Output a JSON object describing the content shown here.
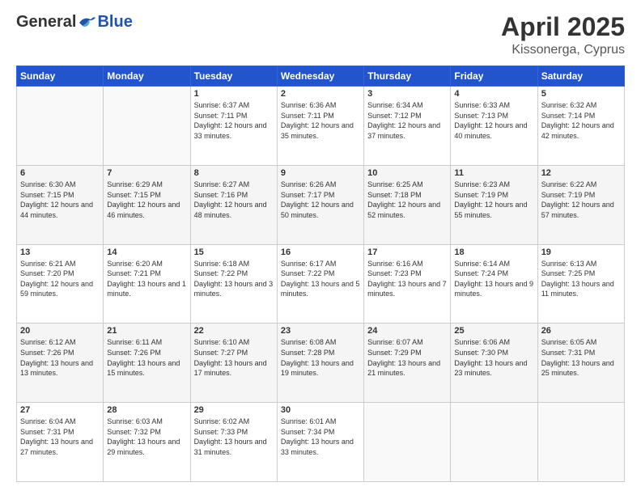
{
  "header": {
    "logo_general": "General",
    "logo_blue": "Blue",
    "title": "April 2025",
    "subtitle": "Kissonerga, Cyprus"
  },
  "calendar": {
    "weekdays": [
      "Sunday",
      "Monday",
      "Tuesday",
      "Wednesday",
      "Thursday",
      "Friday",
      "Saturday"
    ],
    "rows": [
      [
        {
          "day": "",
          "info": ""
        },
        {
          "day": "",
          "info": ""
        },
        {
          "day": "1",
          "info": "Sunrise: 6:37 AM\nSunset: 7:11 PM\nDaylight: 12 hours and 33 minutes."
        },
        {
          "day": "2",
          "info": "Sunrise: 6:36 AM\nSunset: 7:11 PM\nDaylight: 12 hours and 35 minutes."
        },
        {
          "day": "3",
          "info": "Sunrise: 6:34 AM\nSunset: 7:12 PM\nDaylight: 12 hours and 37 minutes."
        },
        {
          "day": "4",
          "info": "Sunrise: 6:33 AM\nSunset: 7:13 PM\nDaylight: 12 hours and 40 minutes."
        },
        {
          "day": "5",
          "info": "Sunrise: 6:32 AM\nSunset: 7:14 PM\nDaylight: 12 hours and 42 minutes."
        }
      ],
      [
        {
          "day": "6",
          "info": "Sunrise: 6:30 AM\nSunset: 7:15 PM\nDaylight: 12 hours and 44 minutes."
        },
        {
          "day": "7",
          "info": "Sunrise: 6:29 AM\nSunset: 7:15 PM\nDaylight: 12 hours and 46 minutes."
        },
        {
          "day": "8",
          "info": "Sunrise: 6:27 AM\nSunset: 7:16 PM\nDaylight: 12 hours and 48 minutes."
        },
        {
          "day": "9",
          "info": "Sunrise: 6:26 AM\nSunset: 7:17 PM\nDaylight: 12 hours and 50 minutes."
        },
        {
          "day": "10",
          "info": "Sunrise: 6:25 AM\nSunset: 7:18 PM\nDaylight: 12 hours and 52 minutes."
        },
        {
          "day": "11",
          "info": "Sunrise: 6:23 AM\nSunset: 7:19 PM\nDaylight: 12 hours and 55 minutes."
        },
        {
          "day": "12",
          "info": "Sunrise: 6:22 AM\nSunset: 7:19 PM\nDaylight: 12 hours and 57 minutes."
        }
      ],
      [
        {
          "day": "13",
          "info": "Sunrise: 6:21 AM\nSunset: 7:20 PM\nDaylight: 12 hours and 59 minutes."
        },
        {
          "day": "14",
          "info": "Sunrise: 6:20 AM\nSunset: 7:21 PM\nDaylight: 13 hours and 1 minute."
        },
        {
          "day": "15",
          "info": "Sunrise: 6:18 AM\nSunset: 7:22 PM\nDaylight: 13 hours and 3 minutes."
        },
        {
          "day": "16",
          "info": "Sunrise: 6:17 AM\nSunset: 7:22 PM\nDaylight: 13 hours and 5 minutes."
        },
        {
          "day": "17",
          "info": "Sunrise: 6:16 AM\nSunset: 7:23 PM\nDaylight: 13 hours and 7 minutes."
        },
        {
          "day": "18",
          "info": "Sunrise: 6:14 AM\nSunset: 7:24 PM\nDaylight: 13 hours and 9 minutes."
        },
        {
          "day": "19",
          "info": "Sunrise: 6:13 AM\nSunset: 7:25 PM\nDaylight: 13 hours and 11 minutes."
        }
      ],
      [
        {
          "day": "20",
          "info": "Sunrise: 6:12 AM\nSunset: 7:26 PM\nDaylight: 13 hours and 13 minutes."
        },
        {
          "day": "21",
          "info": "Sunrise: 6:11 AM\nSunset: 7:26 PM\nDaylight: 13 hours and 15 minutes."
        },
        {
          "day": "22",
          "info": "Sunrise: 6:10 AM\nSunset: 7:27 PM\nDaylight: 13 hours and 17 minutes."
        },
        {
          "day": "23",
          "info": "Sunrise: 6:08 AM\nSunset: 7:28 PM\nDaylight: 13 hours and 19 minutes."
        },
        {
          "day": "24",
          "info": "Sunrise: 6:07 AM\nSunset: 7:29 PM\nDaylight: 13 hours and 21 minutes."
        },
        {
          "day": "25",
          "info": "Sunrise: 6:06 AM\nSunset: 7:30 PM\nDaylight: 13 hours and 23 minutes."
        },
        {
          "day": "26",
          "info": "Sunrise: 6:05 AM\nSunset: 7:31 PM\nDaylight: 13 hours and 25 minutes."
        }
      ],
      [
        {
          "day": "27",
          "info": "Sunrise: 6:04 AM\nSunset: 7:31 PM\nDaylight: 13 hours and 27 minutes."
        },
        {
          "day": "28",
          "info": "Sunrise: 6:03 AM\nSunset: 7:32 PM\nDaylight: 13 hours and 29 minutes."
        },
        {
          "day": "29",
          "info": "Sunrise: 6:02 AM\nSunset: 7:33 PM\nDaylight: 13 hours and 31 minutes."
        },
        {
          "day": "30",
          "info": "Sunrise: 6:01 AM\nSunset: 7:34 PM\nDaylight: 13 hours and 33 minutes."
        },
        {
          "day": "",
          "info": ""
        },
        {
          "day": "",
          "info": ""
        },
        {
          "day": "",
          "info": ""
        }
      ]
    ]
  }
}
